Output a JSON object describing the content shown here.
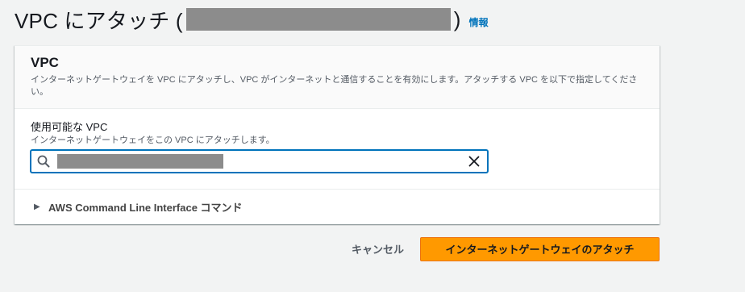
{
  "header": {
    "title_prefix": "VPC にアタッチ (",
    "title_suffix": " )",
    "info_label": "情報"
  },
  "card": {
    "title": "VPC",
    "description": "インターネットゲートウェイを VPC にアタッチし、VPC がインターネットと通信することを有効にします。アタッチする VPC を以下で指定してください。"
  },
  "field": {
    "label": "使用可能な VPC",
    "description": "インターネットゲートウェイをこの VPC にアタッチします。"
  },
  "cli": {
    "label": "AWS Command Line Interface コマンド"
  },
  "actions": {
    "cancel_label": "キャンセル",
    "submit_label": "インターネットゲートウェイのアタッチ"
  },
  "icons": {
    "search": "search-icon",
    "clear": "close-icon",
    "caret": "caret-right-icon"
  },
  "colors": {
    "accent": "#0073bb",
    "primary_button": "#ff9900",
    "page_background": "#f2f3f3"
  }
}
